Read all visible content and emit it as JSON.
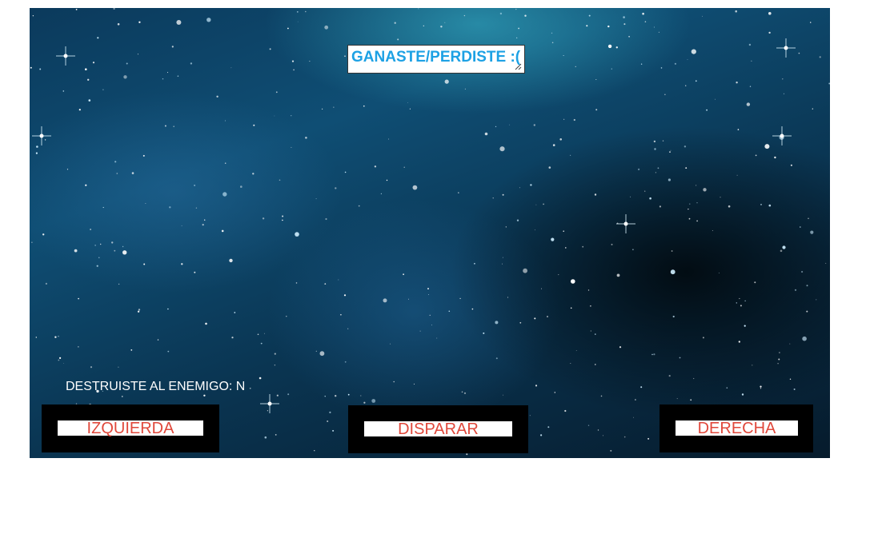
{
  "game": {
    "result_text": "GANASTE/PERDISTE :(",
    "destroyed_label": "DESTRUISTE AL ENEMIGO: N"
  },
  "controls": {
    "left_label": "IZQUIERDA",
    "fire_label": "DISPARAR",
    "right_label": "DERECHA"
  },
  "colors": {
    "result_text": "#1da1e4",
    "button_text": "#e0483b",
    "button_frame": "#000000"
  }
}
